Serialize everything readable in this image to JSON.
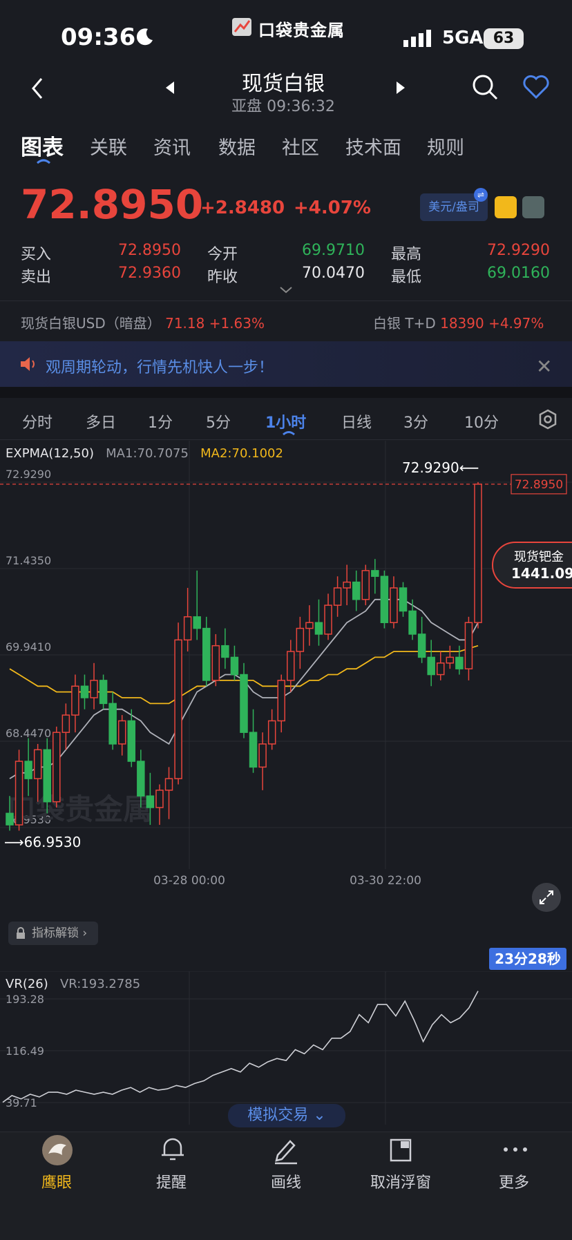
{
  "status_bar": {
    "time": "09:36",
    "network": "5GA",
    "battery": "63",
    "app_logo_text": "口袋贵金属"
  },
  "nav": {
    "title": "现货白银",
    "subtitle": "亚盘 09:36:32"
  },
  "tabs": [
    "图表",
    "关联",
    "资讯",
    "数据",
    "社区",
    "技术面",
    "规则"
  ],
  "quote": {
    "price": "72.8950",
    "change": "+2.8480",
    "change_pct": "+4.07%",
    "currency_toggle": "美元/盎司",
    "bid_label": "买入",
    "bid": "72.8950",
    "ask_label": "卖出",
    "ask": "72.9360",
    "open_label": "今开",
    "open": "69.9710",
    "prev_close_label": "昨收",
    "prev_close": "70.0470",
    "high_label": "最高",
    "high": "72.9290",
    "low_label": "最低",
    "low": "69.0160"
  },
  "tickers": [
    {
      "name": "现货白银USD（暗盘）",
      "price": "71.18",
      "pct": "+1.63%"
    },
    {
      "name": "白银 T+D",
      "price": "18390",
      "pct": "+4.97%"
    }
  ],
  "banner": {
    "text": "观周期轮动，行情先机快人一步！"
  },
  "period_tabs": [
    "分时",
    "多日",
    "1分",
    "5分",
    "1小时",
    "日线",
    "3分",
    "10分"
  ],
  "indicator": {
    "name": "EXPMA(12,50)",
    "ma1": "MA1:70.7075",
    "ma2": "MA2:70.1002"
  },
  "chart_data": {
    "type": "candlestick",
    "y_ticks": [
      "72.9290",
      "71.4350",
      "69.9410",
      "68.4470",
      "66.9530"
    ],
    "ylim": [
      66.953,
      72.929
    ],
    "x_ticks": [
      "03-28 00:00",
      "03-30 22:00"
    ],
    "high_marker": "72.9290",
    "low_marker": "66.9530",
    "last_price_tag": "72.8950",
    "ohlc": [
      [
        67.2,
        67.5,
        66.9,
        67.0
      ],
      [
        67.0,
        68.3,
        66.9,
        68.1
      ],
      [
        68.1,
        68.5,
        67.5,
        67.8
      ],
      [
        67.8,
        68.4,
        67.4,
        68.3
      ],
      [
        68.3,
        68.5,
        67.2,
        67.4
      ],
      [
        67.4,
        68.7,
        67.3,
        68.6
      ],
      [
        68.6,
        69.1,
        68.3,
        68.9
      ],
      [
        68.9,
        69.6,
        68.6,
        69.4
      ],
      [
        69.4,
        69.6,
        69.0,
        69.2
      ],
      [
        69.2,
        69.8,
        69.0,
        69.5
      ],
      [
        69.5,
        69.6,
        69.0,
        69.1
      ],
      [
        69.1,
        69.3,
        68.3,
        68.4
      ],
      [
        68.4,
        68.9,
        68.2,
        68.8
      ],
      [
        68.8,
        69.0,
        68.0,
        68.1
      ],
      [
        68.1,
        68.3,
        67.3,
        67.5
      ],
      [
        67.5,
        67.9,
        67.0,
        67.3
      ],
      [
        67.3,
        67.7,
        67.0,
        67.6
      ],
      [
        67.6,
        68.0,
        67.1,
        67.8
      ],
      [
        67.8,
        70.5,
        67.7,
        70.2
      ],
      [
        70.2,
        71.1,
        70.0,
        70.6
      ],
      [
        70.6,
        71.4,
        70.2,
        70.4
      ],
      [
        70.4,
        70.6,
        69.4,
        69.5
      ],
      [
        69.5,
        70.3,
        69.4,
        70.1
      ],
      [
        70.1,
        70.4,
        69.7,
        69.9
      ],
      [
        69.9,
        70.1,
        69.5,
        69.6
      ],
      [
        69.6,
        69.8,
        68.5,
        68.6
      ],
      [
        68.6,
        69.0,
        67.9,
        68.0
      ],
      [
        68.0,
        68.6,
        67.6,
        68.4
      ],
      [
        68.4,
        69.0,
        68.3,
        68.8
      ],
      [
        68.8,
        69.6,
        68.6,
        69.5
      ],
      [
        69.5,
        70.2,
        69.3,
        70.0
      ],
      [
        70.0,
        70.6,
        69.7,
        70.4
      ],
      [
        70.4,
        70.8,
        70.1,
        70.5
      ],
      [
        70.5,
        70.9,
        70.1,
        70.3
      ],
      [
        70.3,
        71.0,
        70.2,
        70.8
      ],
      [
        70.8,
        71.3,
        70.6,
        71.1
      ],
      [
        71.1,
        71.5,
        70.8,
        71.2
      ],
      [
        71.2,
        71.4,
        70.7,
        70.9
      ],
      [
        70.9,
        71.5,
        70.8,
        71.4
      ],
      [
        71.4,
        71.6,
        71.0,
        71.3
      ],
      [
        71.3,
        71.4,
        70.4,
        70.5
      ],
      [
        70.5,
        71.3,
        70.4,
        71.1
      ],
      [
        71.1,
        71.2,
        70.6,
        70.7
      ],
      [
        70.7,
        70.9,
        70.2,
        70.3
      ],
      [
        70.3,
        70.6,
        69.8,
        69.9
      ],
      [
        69.9,
        70.2,
        69.4,
        69.6
      ],
      [
        69.6,
        70.0,
        69.5,
        69.8
      ],
      [
        69.8,
        70.1,
        69.7,
        69.9
      ],
      [
        69.9,
        70.1,
        69.6,
        69.7
      ],
      [
        69.7,
        70.6,
        69.5,
        70.5
      ],
      [
        70.5,
        72.93,
        70.4,
        72.895
      ]
    ],
    "ma1_line": [
      67.8,
      67.9,
      67.9,
      68.0,
      68.0,
      68.1,
      68.3,
      68.5,
      68.7,
      68.9,
      69.0,
      69.0,
      69.0,
      68.9,
      68.8,
      68.6,
      68.5,
      68.4,
      68.7,
      69.0,
      69.3,
      69.4,
      69.5,
      69.6,
      69.6,
      69.5,
      69.3,
      69.2,
      69.2,
      69.2,
      69.3,
      69.5,
      69.7,
      69.9,
      70.1,
      70.3,
      70.5,
      70.6,
      70.7,
      70.9,
      70.9,
      70.9,
      70.9,
      70.8,
      70.7,
      70.5,
      70.4,
      70.3,
      70.2,
      70.2,
      70.5
    ],
    "ma2_line": [
      69.7,
      69.6,
      69.5,
      69.4,
      69.4,
      69.3,
      69.3,
      69.3,
      69.3,
      69.3,
      69.3,
      69.3,
      69.2,
      69.2,
      69.2,
      69.1,
      69.1,
      69.1,
      69.2,
      69.3,
      69.4,
      69.4,
      69.5,
      69.5,
      69.5,
      69.5,
      69.5,
      69.4,
      69.4,
      69.4,
      69.4,
      69.4,
      69.5,
      69.5,
      69.6,
      69.6,
      69.7,
      69.7,
      69.8,
      69.9,
      69.9,
      70.0,
      70.0,
      70.0,
      70.0,
      70.0,
      70.0,
      70.0,
      70.0,
      70.05,
      70.1
    ]
  },
  "unlock_label": "指标解锁",
  "countdown": "23分28秒",
  "float_badge": {
    "label": "现货钯金",
    "value": "1441.09"
  },
  "vr": {
    "header": "VR(26)",
    "value": "VR:193.2785",
    "y_ticks": [
      "193.28",
      "116.49",
      "39.71"
    ],
    "ylim": [
      39.71,
      193.28
    ],
    "series": [
      40,
      50,
      45,
      52,
      48,
      55,
      55,
      52,
      58,
      55,
      52,
      55,
      52,
      58,
      62,
      55,
      62,
      58,
      60,
      65,
      62,
      68,
      72,
      80,
      85,
      90,
      85,
      98,
      92,
      100,
      105,
      102,
      118,
      112,
      125,
      118,
      135,
      135,
      145,
      170,
      158,
      185,
      185,
      168,
      190,
      162,
      130,
      155,
      170,
      158,
      165,
      180,
      205
    ]
  },
  "sim_trade": "模拟交易",
  "bottom_nav": [
    "鹰眼",
    "提醒",
    "画线",
    "取消浮窗",
    "更多"
  ],
  "colors": {
    "up": "#e8453c",
    "down": "#2fb35a",
    "accent": "#3d6fe0",
    "ma2": "#f2b81b"
  }
}
